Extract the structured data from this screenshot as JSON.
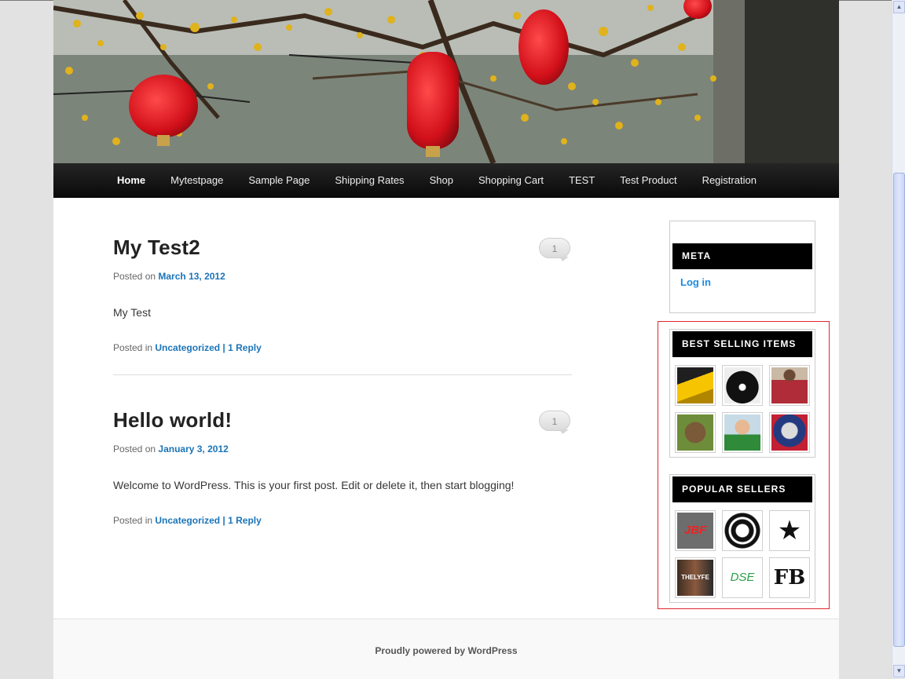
{
  "nav": {
    "items": [
      {
        "label": "Home",
        "active": true
      },
      {
        "label": "Mytestpage"
      },
      {
        "label": "Sample Page"
      },
      {
        "label": "Shipping Rates"
      },
      {
        "label": "Shop"
      },
      {
        "label": "Shopping Cart"
      },
      {
        "label": "TEST"
      },
      {
        "label": "Test Product"
      },
      {
        "label": "Registration"
      }
    ]
  },
  "posts": [
    {
      "title": "My Test2",
      "comment_count": "1",
      "posted_on_label": "Posted on",
      "date": "March 13, 2012",
      "body": "My Test",
      "posted_in_label": "Posted in",
      "category": "Uncategorized",
      "divider": "|",
      "reply": "1 Reply"
    },
    {
      "title": "Hello world!",
      "comment_count": "1",
      "posted_on_label": "Posted on",
      "date": "January 3, 2012",
      "body": "Welcome to WordPress. This is your first post. Edit or delete it, then start blogging!",
      "posted_in_label": "Posted in",
      "category": "Uncategorized",
      "divider": "|",
      "reply": "1 Reply"
    }
  ],
  "sidebar": {
    "meta": {
      "title": "META",
      "link": "Log in"
    },
    "best_selling": {
      "title": "BEST SELLING ITEMS",
      "items": [
        "car-photo",
        "black-tshirt-photo",
        "red-shirt-man-photo",
        "tortoise-photo",
        "child-photo",
        "jersey-photo"
      ]
    },
    "popular_sellers": {
      "title": "POPULAR SELLERS",
      "items": [
        {
          "logo": "JBF"
        },
        {
          "logo": "circle-emblem"
        },
        {
          "logo": "star-graffiti"
        },
        {
          "logo": "THELYFE"
        },
        {
          "logo": "DSE"
        },
        {
          "logo": "FB"
        }
      ]
    }
  },
  "footer": {
    "credit": "Proudly powered by WordPress"
  },
  "colors": {
    "link": "#1b8be0",
    "accent_box": "#e0272d",
    "nav_bg": "#111111"
  }
}
